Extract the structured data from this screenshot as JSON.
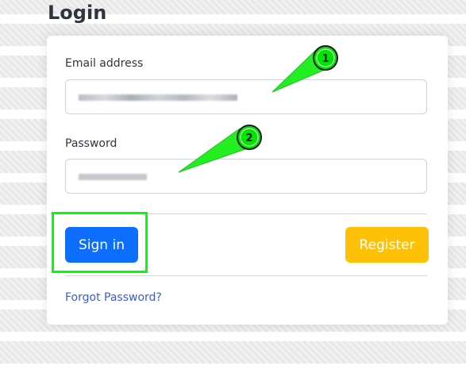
{
  "page": {
    "title": "Login"
  },
  "form": {
    "email_label": "Email address",
    "password_label": "Password",
    "signin_label": "Sign in",
    "register_label": "Register",
    "forgot_label": "Forgot Password?"
  },
  "annotations": {
    "step1": "1",
    "step2": "2",
    "highlight_color": "#00ff00",
    "arrow_color": "#22ee22"
  },
  "colors": {
    "primary": "#0d6efd",
    "warning": "#ffc107",
    "link": "#3b5bdb"
  }
}
